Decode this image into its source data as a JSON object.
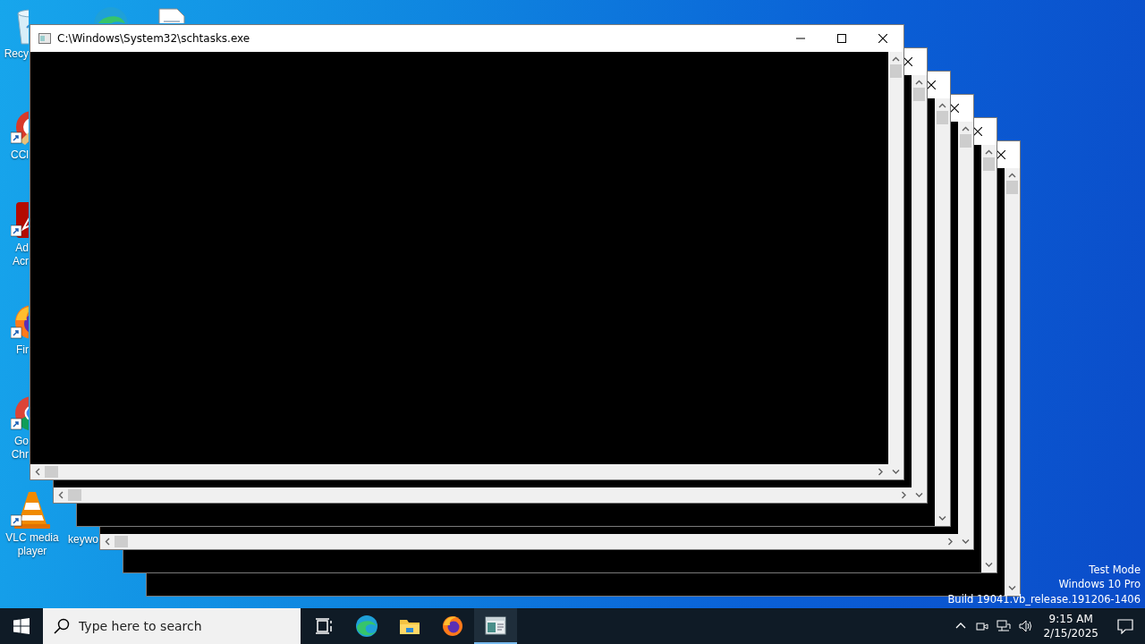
{
  "desktop_icons": [
    {
      "kind": "recycle",
      "label_lines": [
        "Recy"
      ]
    },
    {
      "kind": "edge"
    },
    {
      "kind": "document"
    },
    {
      "kind": "ccleaner",
      "label_lines": [
        "CCl"
      ]
    },
    {
      "kind": "acrobat",
      "label_lines": [
        "Ad",
        "Acr"
      ]
    },
    {
      "kind": "firefox",
      "label_lines": [
        "Fir"
      ]
    },
    {
      "kind": "chrome",
      "label_lines": [
        "Go",
        "Chr"
      ]
    },
    {
      "kind": "vlc",
      "label_lines": [
        "VLC media",
        "player"
      ]
    },
    {
      "label_lines": [
        "keywo"
      ]
    }
  ],
  "windows": [
    {
      "title": "C:\\Windows\\System32\\schtasks.exe",
      "active": true,
      "horizontal_scrollbar": true
    },
    {
      "active": false,
      "horizontal_scrollbar": true
    },
    {
      "active": false,
      "horizontal_scrollbar": false
    },
    {
      "active": false,
      "horizontal_scrollbar": true
    },
    {
      "active": false,
      "horizontal_scrollbar": false
    },
    {
      "active": false,
      "horizontal_scrollbar": false
    }
  ],
  "watermark": [
    "Test Mode",
    "Windows 10 Pro",
    "Build 19041.vb_release.191206-1406"
  ],
  "taskbar": {
    "search": {
      "placeholder": "Type here to search"
    },
    "apps": [
      {
        "kind": "taskview",
        "active": false
      },
      {
        "kind": "edge",
        "active": false
      },
      {
        "kind": "explorer",
        "active": false
      },
      {
        "kind": "firefox",
        "active": false
      },
      {
        "kind": "console",
        "active": true
      }
    ],
    "clock": {
      "time": "9:15 AM",
      "date": "2/15/2025"
    }
  }
}
